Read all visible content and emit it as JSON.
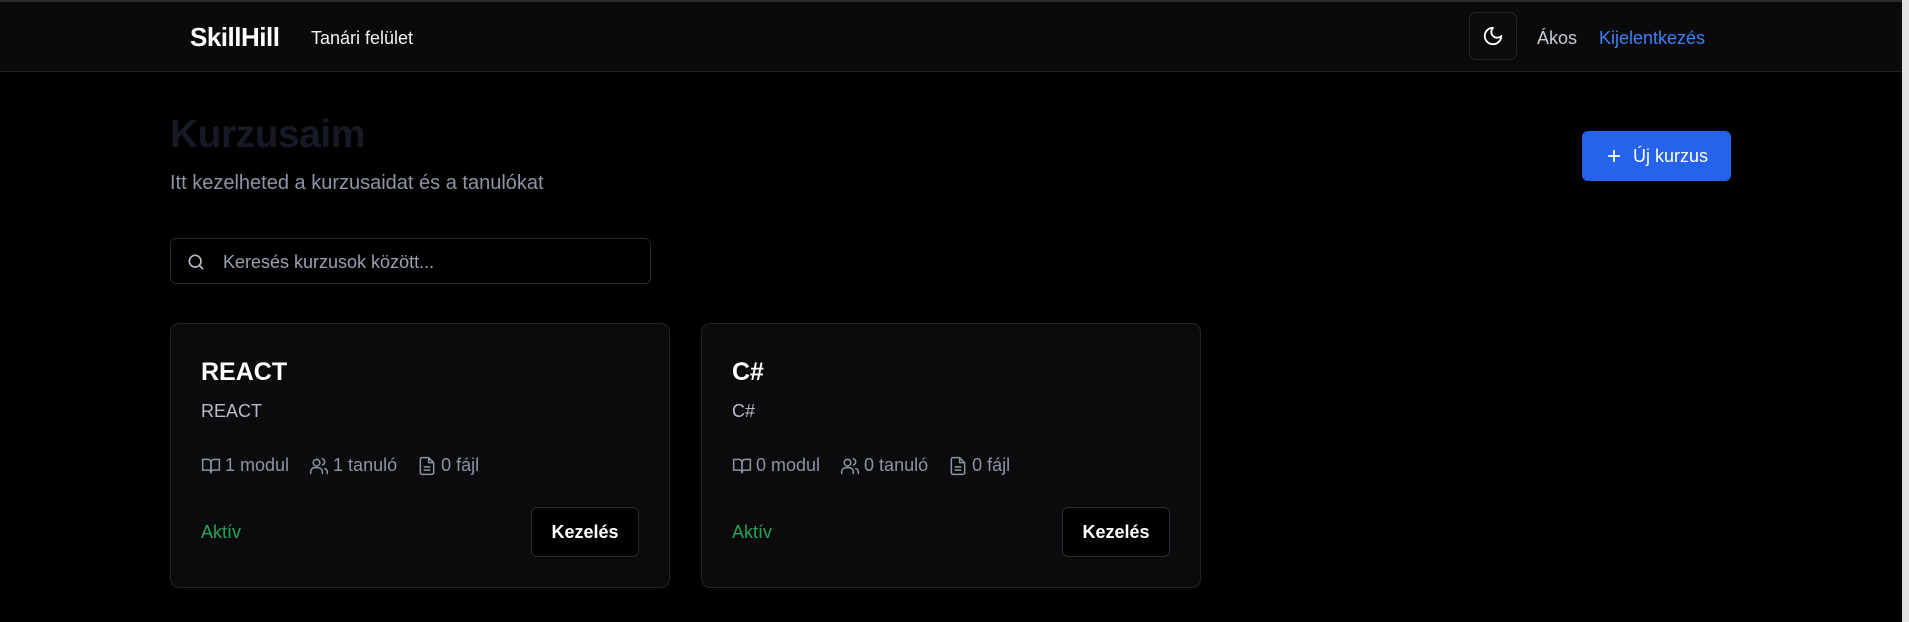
{
  "header": {
    "brand": "SkillHill",
    "subtitle": "Tanári felület",
    "theme_icon": "moon-icon",
    "user_name": "Ákos",
    "logout_label": "Kijelentkezés"
  },
  "page": {
    "title": "Kurzusaim",
    "description": "Itt kezelheted a kurzusaidat és a tanulókat",
    "new_course_label": "Új kurzus"
  },
  "search": {
    "placeholder": "Keresés kurzusok között..."
  },
  "courses": [
    {
      "title": "REACT",
      "description": "REACT",
      "modules": "1 modul",
      "students": "1 tanuló",
      "files": "0 fájl",
      "status": "Aktív",
      "manage_label": "Kezelés"
    },
    {
      "title": "C#",
      "description": "C#",
      "modules": "0 modul",
      "students": "0 tanuló",
      "files": "0 fájl",
      "status": "Aktív",
      "manage_label": "Kezelés"
    }
  ],
  "colors": {
    "accent": "#2563eb",
    "link": "#3b82f6",
    "status_active": "#22a55a",
    "background": "#000000"
  }
}
